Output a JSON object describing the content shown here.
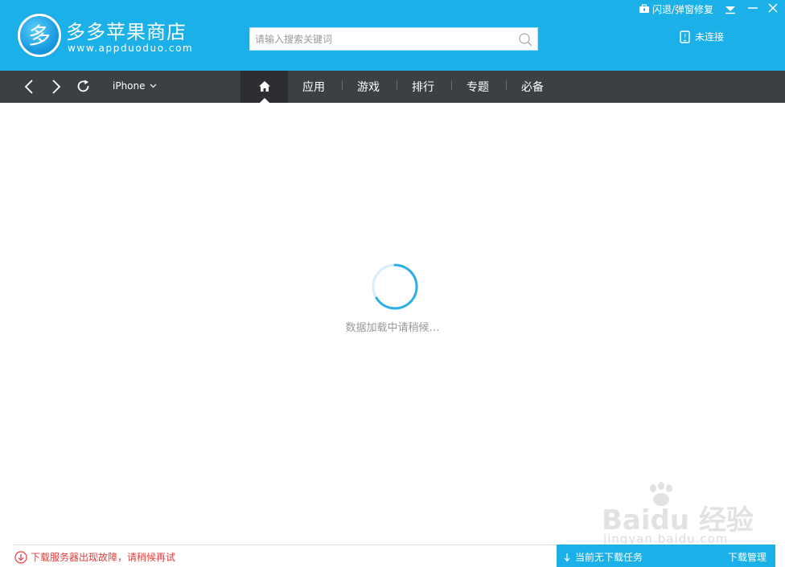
{
  "app": {
    "title": "多多苹果商店",
    "url": "www.appduoduo.com",
    "logo_glyph": "多",
    "brand_color": "#1cb0e8",
    "navbar_color": "#3c3f44"
  },
  "search": {
    "placeholder": "请输入搜索关键词",
    "value": ""
  },
  "window_controls": {
    "repair_label": "闪退/弹窗修复"
  },
  "device": {
    "status": "未连接",
    "selected": "iPhone"
  },
  "nav": {
    "tabs": [
      {
        "label": "应用"
      },
      {
        "label": "游戏"
      },
      {
        "label": "排行"
      },
      {
        "label": "专题"
      },
      {
        "label": "必备"
      }
    ]
  },
  "main": {
    "loading_text": "数据加载中请稍候…"
  },
  "watermark": {
    "text": "Baidu 经验",
    "sub": "jingyan.baidu.com"
  },
  "status": {
    "error_text": "下载服务器出现故障，请稍候再试",
    "error_color": "#e23b3b",
    "download_status": "当前无下载任务",
    "download_manage": "下载管理"
  }
}
